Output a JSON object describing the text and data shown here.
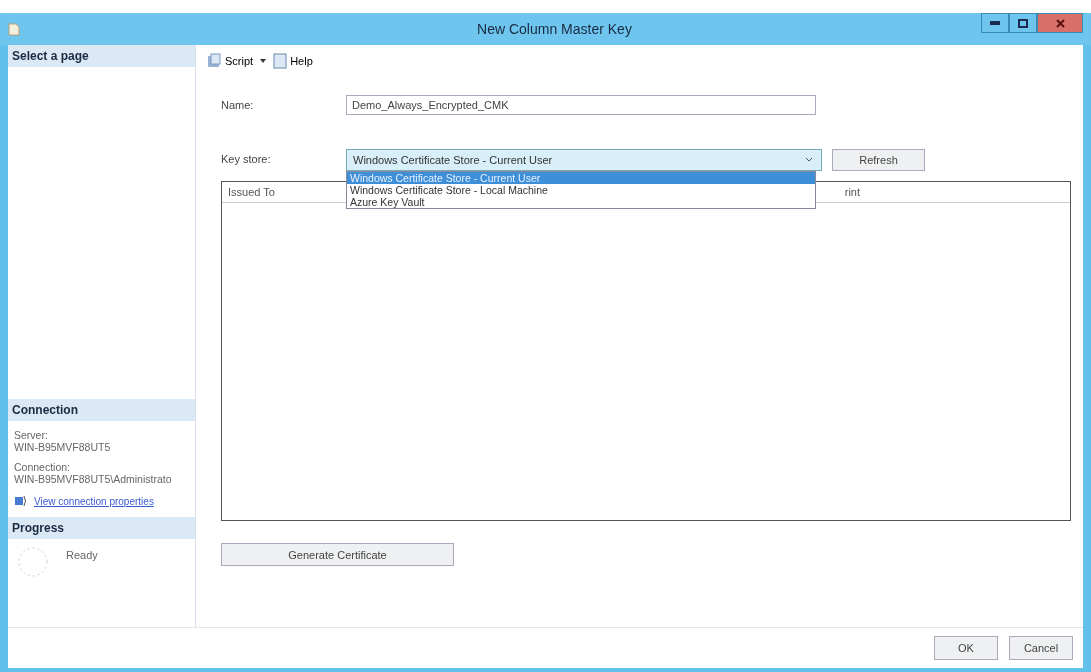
{
  "window": {
    "title": "New Column Master Key"
  },
  "sidebar": {
    "select_page_header": "Select a page",
    "connection_header": "Connection",
    "server_label": "Server:",
    "server_value": "WIN-B95MVF88UT5",
    "connection_label": "Connection:",
    "connection_value": "WIN-B95MVF88UT5\\Administrato",
    "connection_link": "View connection properties",
    "progress_header": "Progress",
    "progress_status": "Ready"
  },
  "toolbar": {
    "script": "Script",
    "help": "Help"
  },
  "form": {
    "name_label": "Name:",
    "name_value": "Demo_Always_Encrypted_CMK",
    "key_store_label": "Key store:",
    "key_store_value": "Windows Certificate Store - Current User",
    "refresh": "Refresh",
    "key_store_options": [
      {
        "label": "Windows Certificate Store - Current User",
        "selected": true
      },
      {
        "label": "Windows Certificate Store - Local Machine",
        "selected": false
      },
      {
        "label": "Azure Key Vault",
        "selected": false
      }
    ]
  },
  "table": {
    "columns": [
      "Issued To",
      "rint"
    ]
  },
  "generate_button": "Generate Certificate",
  "buttons": [
    "OK",
    "Cancel"
  ]
}
